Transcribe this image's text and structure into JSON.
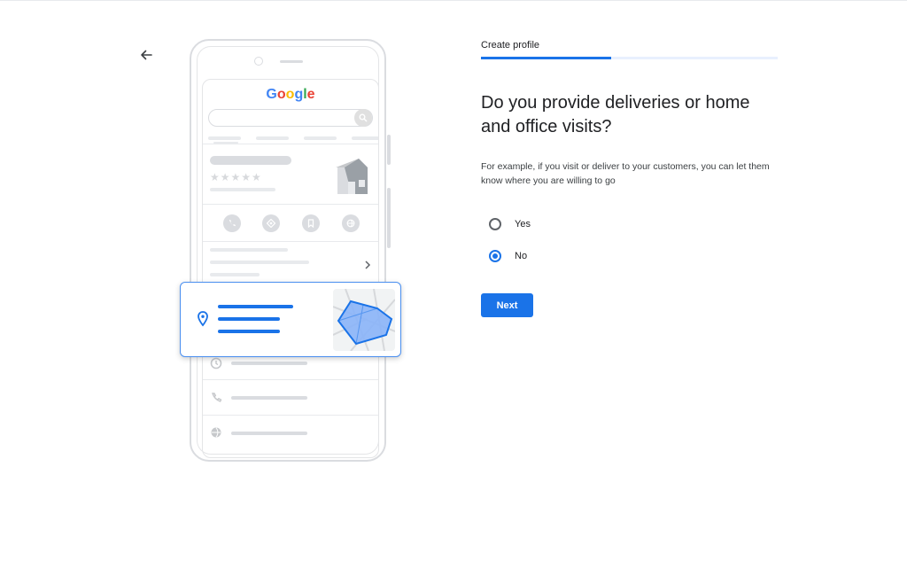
{
  "header": {
    "back_icon": "arrow-back-icon",
    "step_label": "Create profile",
    "progress": 0.44
  },
  "illustration": {
    "logo_text": "Google",
    "stars": "★★★★★",
    "icons": [
      "phone-icon",
      "directions-icon",
      "bookmark-icon",
      "globe-icon",
      "clock-icon",
      "location-pin-icon",
      "map-icon",
      "search-icon",
      "store-icon",
      "chevron-right-icon"
    ]
  },
  "question": {
    "heading": "Do you provide deliveries or home and office visits?",
    "description": "For example, if you visit or deliver to your customers, you can let them know where you are willing to go",
    "options": [
      {
        "label": "Yes",
        "selected": false
      },
      {
        "label": "No",
        "selected": true
      }
    ]
  },
  "actions": {
    "next_label": "Next"
  },
  "colors": {
    "accent": "#1a73e8",
    "progress_track": "#e8f0fe",
    "illustration_gray": "#dadce0",
    "map_fill": "#8ab4f8"
  }
}
